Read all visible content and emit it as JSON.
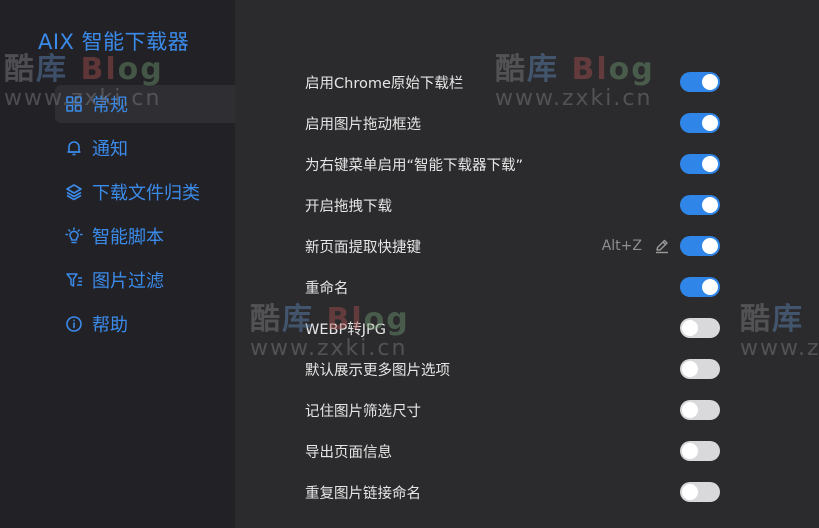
{
  "app": {
    "title": "AIX 智能下载器"
  },
  "sidebar": {
    "items": [
      {
        "label": "常规",
        "icon": "grid-icon",
        "active": true
      },
      {
        "label": "通知",
        "icon": "bell-icon",
        "active": false
      },
      {
        "label": "下载文件归类",
        "icon": "layers-icon",
        "active": false
      },
      {
        "label": "智能脚本",
        "icon": "lightbulb-icon",
        "active": false
      },
      {
        "label": "图片过滤",
        "icon": "filter-icon",
        "active": false
      },
      {
        "label": "帮助",
        "icon": "info-icon",
        "active": false
      }
    ]
  },
  "settings": [
    {
      "label": "启用Chrome原始下载栏",
      "enabled": true
    },
    {
      "label": "启用图片拖动框选",
      "enabled": true
    },
    {
      "label": "为右键菜单启用“智能下载器下载”",
      "enabled": true
    },
    {
      "label": "开启拖拽下载",
      "enabled": true
    },
    {
      "label": "新页面提取快捷键",
      "enabled": true,
      "shortcut": "Alt+Z",
      "editable": true
    },
    {
      "label": "重命名",
      "enabled": true
    },
    {
      "label": "WEBP转JPG",
      "enabled": false
    },
    {
      "label": "默认展示更多图片选项",
      "enabled": false
    },
    {
      "label": "记住图片筛选尺寸",
      "enabled": false
    },
    {
      "label": "导出页面信息",
      "enabled": false
    },
    {
      "label": "重复图片链接命名",
      "enabled": false
    }
  ],
  "watermark": {
    "chars": [
      "酷",
      "库",
      "Bl",
      "og"
    ],
    "url": "www.zxki.cn"
  },
  "colors": {
    "accent": "#3b8bea",
    "toggle_on": "#2f86e8",
    "toggle_off": "#d9d9db",
    "sidebar_bg": "#222126",
    "main_bg": "#2b2b2d"
  }
}
